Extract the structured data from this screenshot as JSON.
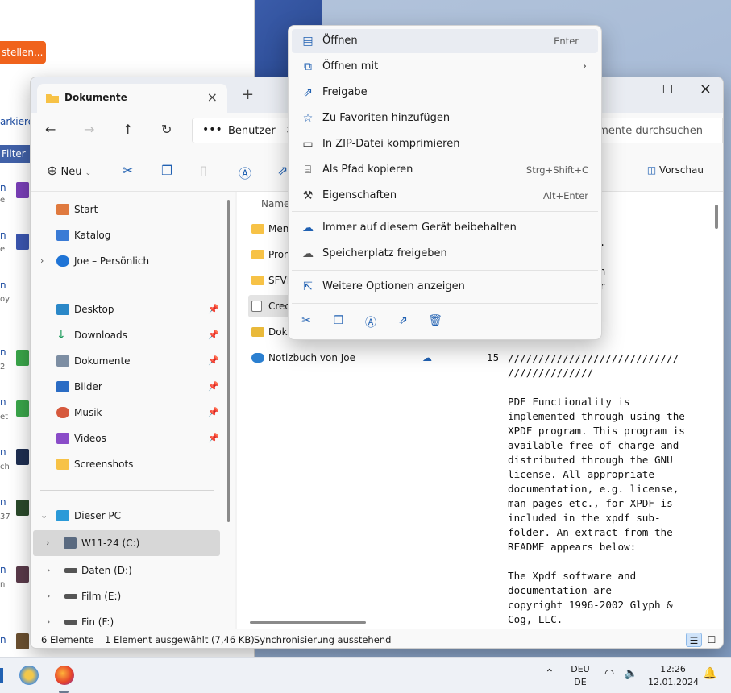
{
  "background_window": {
    "orange_button_label": "stellen...",
    "strip_labels": [
      "arkiere",
      "n",
      "n",
      "n",
      "n",
      "n",
      "n",
      "n",
      "n",
      "n"
    ],
    "sub_labels": [
      "el",
      "e",
      "oy",
      "2",
      "et",
      "ch",
      "37",
      "n"
    ],
    "filter_label": "Filter"
  },
  "explorer": {
    "tab_title": "Dokumente",
    "address": {
      "dots": "•••",
      "segment": "Benutzer",
      "separator": ">"
    },
    "search_placeholder": "umente durchsuchen",
    "commands": {
      "new_label": "Neu",
      "preview_label": "Vorschau"
    },
    "navigation": {
      "top": [
        {
          "label": "Start",
          "icon": "home-icon"
        },
        {
          "label": "Katalog",
          "icon": "gallery-icon"
        },
        {
          "label": "Joe – Persönlich",
          "icon": "onedrive-cloud-icon"
        }
      ],
      "quick_access": [
        {
          "label": "Desktop",
          "icon": "desktop-icon"
        },
        {
          "label": "Downloads",
          "icon": "download-arrow-icon"
        },
        {
          "label": "Dokumente",
          "icon": "documents-icon"
        },
        {
          "label": "Bilder",
          "icon": "pictures-icon"
        },
        {
          "label": "Musik",
          "icon": "music-icon"
        },
        {
          "label": "Videos",
          "icon": "videos-icon"
        },
        {
          "label": "Screenshots",
          "icon": "folder-icon"
        }
      ],
      "this_pc": "Dieser PC",
      "drives": [
        "W11-24 (C:)",
        "Daten (D:)",
        "Film (E:)",
        "Fin (F:)"
      ]
    },
    "file_list": {
      "column_name": "Name",
      "files": [
        "Men",
        "Pron",
        "SFVII",
        "Cred",
        "Doku",
        "Notizbuch von Joe"
      ],
      "notizbuch_date": "15.0"
    },
    "preview_text": "users for\ngreat feedback\n keep this\nquality product.\n\n to David Horton\nolihan for their\nting, feedback,\n\n\n\n////////////////////////////\n//////////////\n\nPDF Functionality is\nimplemented through using the\nXPDF program. This program is\navailable free of charge and\ndistributed through the GNU\nlicense. All appropriate\ndocumentation, e.g. license,\nman pages etc., for XPDF is\nincluded in the xpdf sub-\nfolder. An extract from the\nREADME appears below:\n\nThe Xpdf software and\ndocumentation are\ncopyright 1996-2002 Glyph &\nCog, LLC.",
    "status": {
      "count": "6 Elemente",
      "selected": "1 Element ausgewählt (7,46 KB)",
      "sync": "Synchronisierung ausstehend"
    }
  },
  "context_menu": {
    "items_group1": [
      {
        "label": "Öffnen",
        "shortcut": "Enter",
        "icon": "notepad-icon"
      },
      {
        "label": "Öffnen mit",
        "shortcut": "",
        "icon": "open-with-icon",
        "submenu": true
      },
      {
        "label": "Freigabe",
        "shortcut": "",
        "icon": "share-icon"
      },
      {
        "label": "Zu Favoriten hinzufügen",
        "shortcut": "",
        "icon": "star-icon"
      },
      {
        "label": "In ZIP-Datei komprimieren",
        "shortcut": "",
        "icon": "zip-icon"
      },
      {
        "label": "Als Pfad kopieren",
        "shortcut": "Strg+Shift+C",
        "icon": "copy-path-icon"
      },
      {
        "label": "Eigenschaften",
        "shortcut": "Alt+Enter",
        "icon": "wrench-icon"
      }
    ],
    "items_group2": [
      {
        "label": "Immer auf diesem Gerät beibehalten",
        "icon": "cloud-check-icon"
      },
      {
        "label": "Speicherplatz freigeben",
        "icon": "cloud-icon"
      }
    ],
    "items_group3": [
      {
        "label": "Weitere Optionen anzeigen",
        "icon": "more-options-icon"
      }
    ],
    "quick_actions": [
      "cut-icon",
      "copy-icon",
      "rename-icon",
      "share-icon",
      "delete-icon"
    ]
  },
  "taskbar": {
    "language_top": "DEU",
    "language_bottom": "DE",
    "time": "12:26",
    "date": "12.01.2024"
  }
}
